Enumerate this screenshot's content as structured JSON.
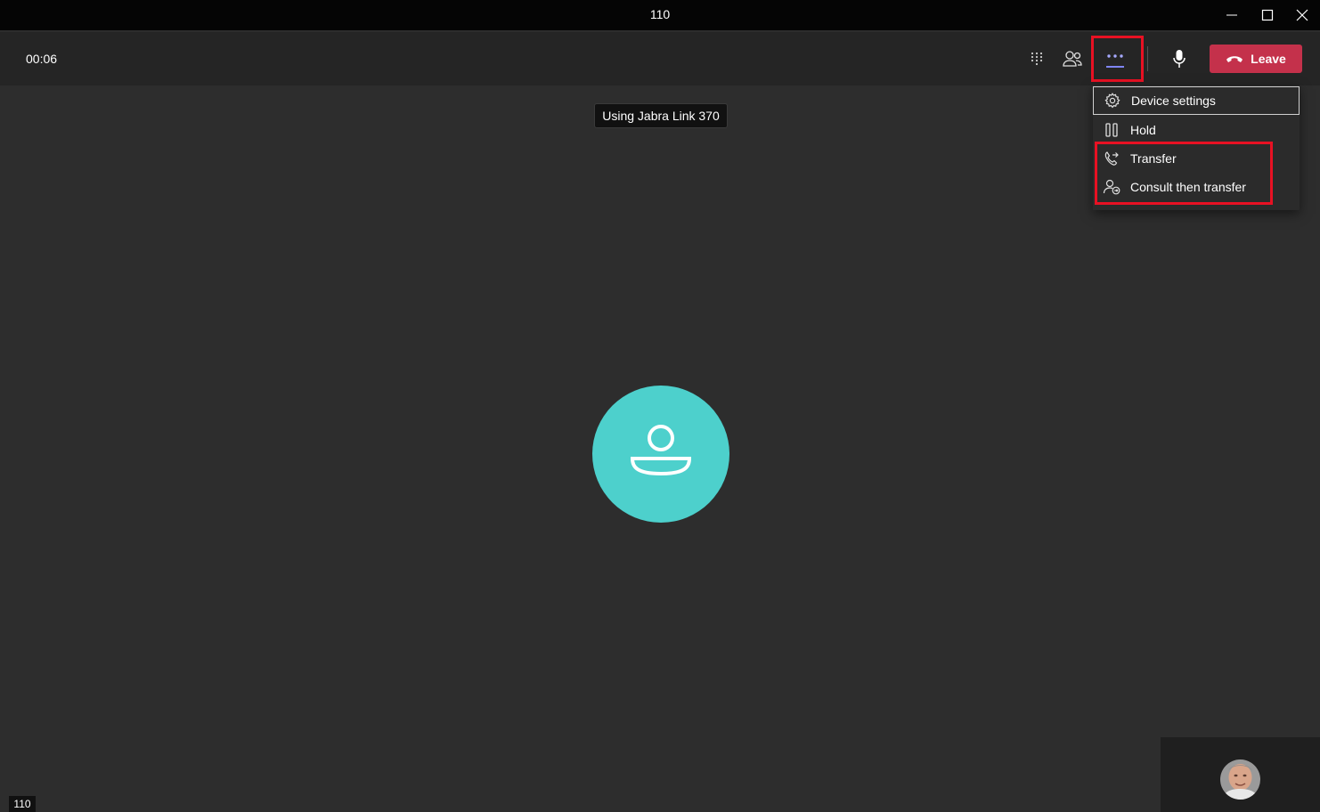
{
  "window": {
    "title": "110",
    "controls": [
      "minimize-icon",
      "maximize-icon",
      "close-icon"
    ]
  },
  "toolbar": {
    "timer": "00:06",
    "icons": [
      "dialpad-icon",
      "people-icon",
      "more-options-icon",
      "microphone-icon"
    ],
    "leave_label": "Leave"
  },
  "tooltip": "Using Jabra Link 370",
  "menu": {
    "items": [
      {
        "label": "Device settings",
        "icon": "gear-icon"
      },
      {
        "label": "Hold",
        "icon": "pause-icon"
      },
      {
        "label": "Transfer",
        "icon": "transfer-icon"
      },
      {
        "label": "Consult then transfer",
        "icon": "consult-transfer-icon"
      }
    ]
  },
  "call": {
    "participant_label": "110"
  },
  "colors": {
    "leave": "#c4314b",
    "avatar": "#4dd0cc",
    "accent": "#7f85f5",
    "highlight": "#e81123"
  }
}
